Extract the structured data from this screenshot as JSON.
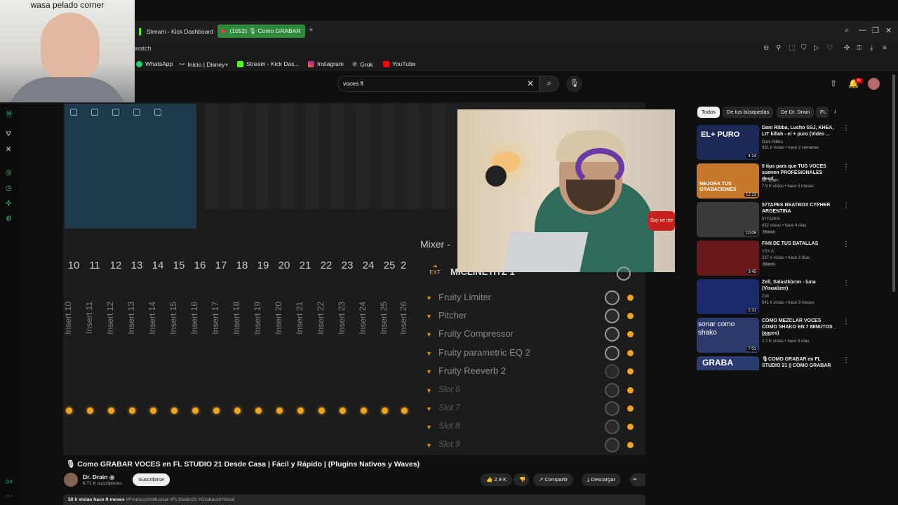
{
  "webcam": {
    "label": "wasa pelado corner"
  },
  "tabs": [
    {
      "label": "Stream - Kick Dashboard"
    },
    {
      "label": "(1052) 🎙 Como GRABAR"
    }
  ],
  "address": {
    "url": "watch"
  },
  "bookmarks": [
    "WhatsApp",
    "Inicio | Disney+",
    "Stream - Kick Das...",
    "Instagram",
    "Grok",
    "YouTube"
  ],
  "search": {
    "query": "voces fl"
  },
  "notifications": {
    "count": "9+"
  },
  "chips": [
    "Todos",
    "De tus búsquedas",
    "De Dr. Drain",
    "FL"
  ],
  "video_overlay": {
    "mixer_title": "Mixer -",
    "mixer_track": "MICLINETITZ 1",
    "ext_label": "EXT",
    "track_numbers": [
      "10",
      "11",
      "12",
      "13",
      "14",
      "15",
      "16",
      "17",
      "18",
      "19",
      "20",
      "21",
      "22",
      "23",
      "24",
      "25",
      "2"
    ],
    "inserts": [
      "Insert 10",
      "Insert 11",
      "Insert 12",
      "Insert 13",
      "Insert 14",
      "Insert 15",
      "Insert 16",
      "Insert 17",
      "Insert 18",
      "Insert 19",
      "Insert 20",
      "Insert 21",
      "Insert 22",
      "Insert 23",
      "Insert 24",
      "Insert 25",
      "Insert 26"
    ],
    "slots": [
      {
        "name": "Fruity Limiter",
        "empty": false
      },
      {
        "name": "Pitcher",
        "empty": false
      },
      {
        "name": "Fruity Compressor",
        "empty": false
      },
      {
        "name": "Fruity parametric EQ 2",
        "empty": false
      },
      {
        "name": "Fruity Reeverb 2",
        "empty": false
      },
      {
        "name": "Slot 6",
        "empty": true
      },
      {
        "name": "Slot 7",
        "empty": true
      },
      {
        "name": "Slot 8",
        "empty": true
      },
      {
        "name": "Slot 9",
        "empty": true
      }
    ],
    "sign_text": "Suy ve me"
  },
  "video": {
    "title": "Como GRABAR VOCES en FL STUDIO 21 Desde Casa | Fácil y Rápido | (Plugins Nativos y Waves)",
    "channel": "Dr. Drain",
    "subscribers": "8.71 K suscriptores",
    "subscribe_label": "Suscribirse",
    "likes": "2.9 K",
    "share_label": "Compartir",
    "download_label": "Descargar",
    "stats": "50 k vistas  hace 9 meses",
    "hashtags": "#ProducciónMusical #FLStudio21 #GrabaciónVocal"
  },
  "recommendations": [
    {
      "title": "Dani Ribba, Lucho SSJ, KHEA, LIT killah - el + puro (Video ...",
      "channel": "Dani Ribba",
      "meta": "991 k vistas • hace 2 semanas",
      "duration": "4:14",
      "thumb_text": "EL+ PURO",
      "thumb_color": "#1a2a55",
      "nuevo": ""
    },
    {
      "title": "5 tips para que TUS VOCES suenen PROFESIONALES desd...",
      "channel": "Dr. Drain",
      "meta": "7.9 K vistas • hace 5 meses",
      "duration": "12:13",
      "thumb_text": "MEJORA TUS GRABACIONES",
      "thumb_color": "#c8782a",
      "nuevo": ""
    },
    {
      "title": "57TAPES BEATBOX CYPHER ARGENTINA",
      "channel": "57TAPES",
      "meta": "432 vistas • hace 4 días",
      "duration": "10:05",
      "thumb_text": "",
      "thumb_color": "#3a3a3a",
      "nuevo": "Nuevo"
    },
    {
      "title": "FAN DE TUS BATALLAS",
      "channel": "YSY A",
      "meta": "237 k vistas • hace 3 días",
      "duration": "3:45",
      "thumb_text": "",
      "thumb_color": "#6a1a1a",
      "nuevo": "Nuevo"
    },
    {
      "title": "Zell, Salastkbron - luna (Visualizer)",
      "channel": "Zell",
      "meta": "541 k vistas • hace 3 meses",
      "duration": "2:31",
      "thumb_text": "",
      "thumb_color": "#1b2a6a",
      "nuevo": ""
    },
    {
      "title": "COMO MEZCLAR VOCES COMO SHAKO EN 7 MINUTOS (voces)",
      "channel": "nadir",
      "meta": "2.2 K vistas • hace 9 días",
      "duration": "7:01",
      "thumb_text": "sonar como shako",
      "thumb_color": "#2b3a6a",
      "nuevo": ""
    },
    {
      "title": "🎙COMO GRABAR en FL STUDIO 21 || COMO GRABAR",
      "channel": "",
      "meta": "",
      "duration": "",
      "thumb_text": "GRABA",
      "thumb_color": "#2a3c70",
      "nuevo": ""
    }
  ],
  "colors": {
    "accent": "#3cbf7b",
    "brand_red": "#cc0000",
    "orange_led": "#f0a51c"
  }
}
